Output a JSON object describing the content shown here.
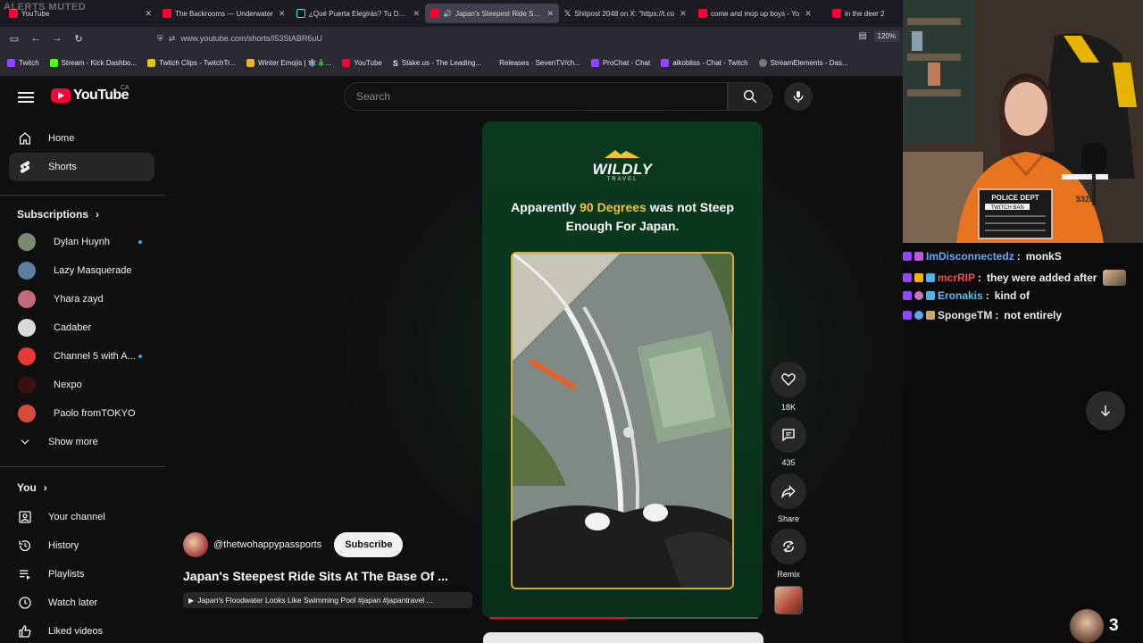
{
  "overlay": {
    "alerts_text": "ALERTS MUTED"
  },
  "tabs": [
    {
      "title": "YouTube",
      "color": "#ff0033"
    },
    {
      "title": "The Backrooms — Underwater",
      "color": "#ff0033"
    },
    {
      "title": "¿Qué Puerta Elegirás? Tu Destin",
      "color": "#111111"
    },
    {
      "title": "Japan's Steepest Ride Sits A",
      "color": "#ff0033",
      "active": true
    },
    {
      "title": "Shitpost 2048 on X: \"https://t.co",
      "color": "#000000"
    },
    {
      "title": "come and mop up boys - Yo",
      "color": "#ff0033"
    },
    {
      "title": "in the deer 2",
      "color": "#ff0033"
    }
  ],
  "browser": {
    "url": "www.youtube.com/shorts/I53StABR6uU",
    "zoom": "120%"
  },
  "bookmarks": [
    {
      "label": "Twitch",
      "color": "#9146ff"
    },
    {
      "label": "Stream - Kick Dashbo...",
      "color": "#53fc18"
    },
    {
      "label": "Twitch Clips - TwitchTr...",
      "color": "#9146ff"
    },
    {
      "label": "Winter Emojis | ❄️🎄...",
      "color": "#e8b33a"
    },
    {
      "label": "YouTube",
      "color": "#ff0033"
    },
    {
      "label": "Stake.us - The Leading...",
      "color": "#1a2c38"
    },
    {
      "label": "Releases · SevenTV/ch...",
      "color": "#2b2a33"
    },
    {
      "label": "ProChat - Chat",
      "color": "#9146ff"
    },
    {
      "label": "aikobliss - Chat - Twitch",
      "color": "#9146ff"
    },
    {
      "label": "StreamElements - Das...",
      "color": "#444"
    }
  ],
  "yt": {
    "logo_text": "YouTube",
    "country": "CA",
    "search_placeholder": "Search",
    "nav": [
      {
        "label": "Home",
        "icon": "home-icon"
      },
      {
        "label": "Shorts",
        "icon": "shorts-icon",
        "active": true
      }
    ],
    "subscriptions_title": "Subscriptions",
    "subscriptions": [
      {
        "name": "Dylan Huynh",
        "color": "#7a8a6e",
        "live_dot": true
      },
      {
        "name": "Lazy Masquerade",
        "color": "#5a7fa0",
        "live_dot": false
      },
      {
        "name": "Yhara zayd",
        "color": "#c06a7c",
        "live_dot": false
      },
      {
        "name": "Cadaber",
        "color": "#d9d9d9",
        "live_dot": false
      },
      {
        "name": "Channel 5 with A...",
        "color": "#e53935",
        "live_dot": true
      },
      {
        "name": "Nexpo",
        "color": "#3a1010",
        "live_dot": false
      },
      {
        "name": "Paolo fromTOKYO",
        "color": "#d84a3a",
        "live_dot": false
      }
    ],
    "show_more": "Show more",
    "you_title": "You",
    "you_items": [
      {
        "label": "Your channel",
        "icon": "channel-icon"
      },
      {
        "label": "History",
        "icon": "history-icon"
      },
      {
        "label": "Playlists",
        "icon": "playlists-icon"
      },
      {
        "label": "Watch later",
        "icon": "clock-icon"
      },
      {
        "label": "Liked videos",
        "icon": "thumbs-up-icon"
      }
    ]
  },
  "short": {
    "brand": "WILDLY",
    "brand_sub": "TRAVEL",
    "headline_prefix": "Apparently ",
    "headline_accent": "90 Degrees",
    "headline_suffix": " was not Steep Enough For Japan.",
    "accent_color": "#f2c230",
    "progress": 0.51,
    "channel": "@thetwohappypassports",
    "subscribe_label": "Subscribe",
    "title": "Japan's Steepest Ride Sits At The Base Of ...",
    "related": "Japan's Floodwater Looks Like Swimming Pool #japan #japantravel ...",
    "actions": {
      "like": "18K",
      "comments": "435",
      "share": "Share",
      "remix": "Remix"
    }
  },
  "chat": [
    {
      "user": "ImDisconnectedz",
      "message": "monkS",
      "color": "#6aa8ff"
    },
    {
      "user": "mcrRIP",
      "message": "they were added after",
      "color": "#ff4a4a"
    },
    {
      "user": "Eronakis",
      "message": "kind of",
      "color": "#4fc3f7"
    },
    {
      "user": "SpongeTM",
      "message": "not entirely",
      "color": "#e6e6e6"
    }
  ],
  "viewer_count": "3"
}
